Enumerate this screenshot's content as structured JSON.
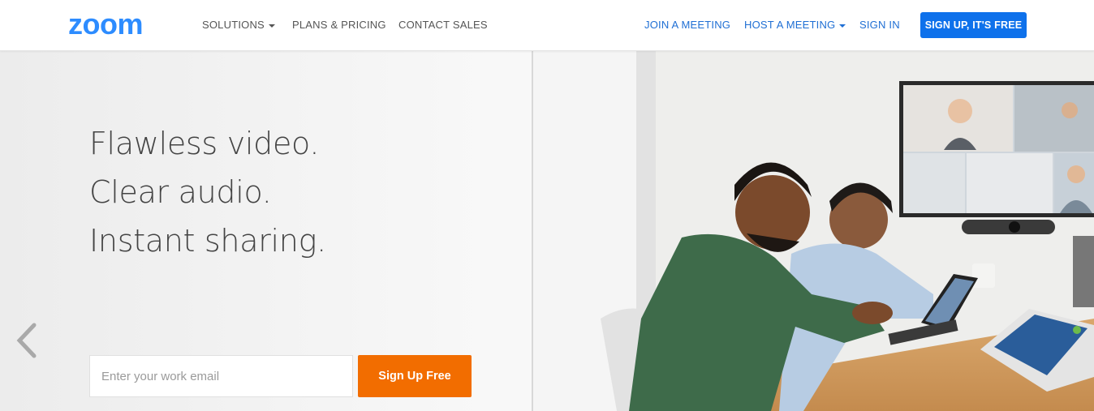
{
  "brand": {
    "logo_text": "zoom",
    "logo_color": "#2d8cff"
  },
  "nav": {
    "solutions": "SOLUTIONS",
    "plans": "PLANS & PRICING",
    "contact": "CONTACT SALES",
    "join": "JOIN A MEETING",
    "host": "HOST A MEETING",
    "signin": "SIGN IN",
    "signup": "SIGN UP, IT'S FREE"
  },
  "hero": {
    "line1": "Flawless video.",
    "line2": "Clear audio.",
    "line3": "Instant sharing.",
    "email_placeholder": "Enter your work email",
    "cta_label": "Sign Up Free"
  },
  "colors": {
    "accent_blue": "#0e71eb",
    "cta_orange": "#f26d00",
    "sweater_green": "#3e6b4a"
  }
}
